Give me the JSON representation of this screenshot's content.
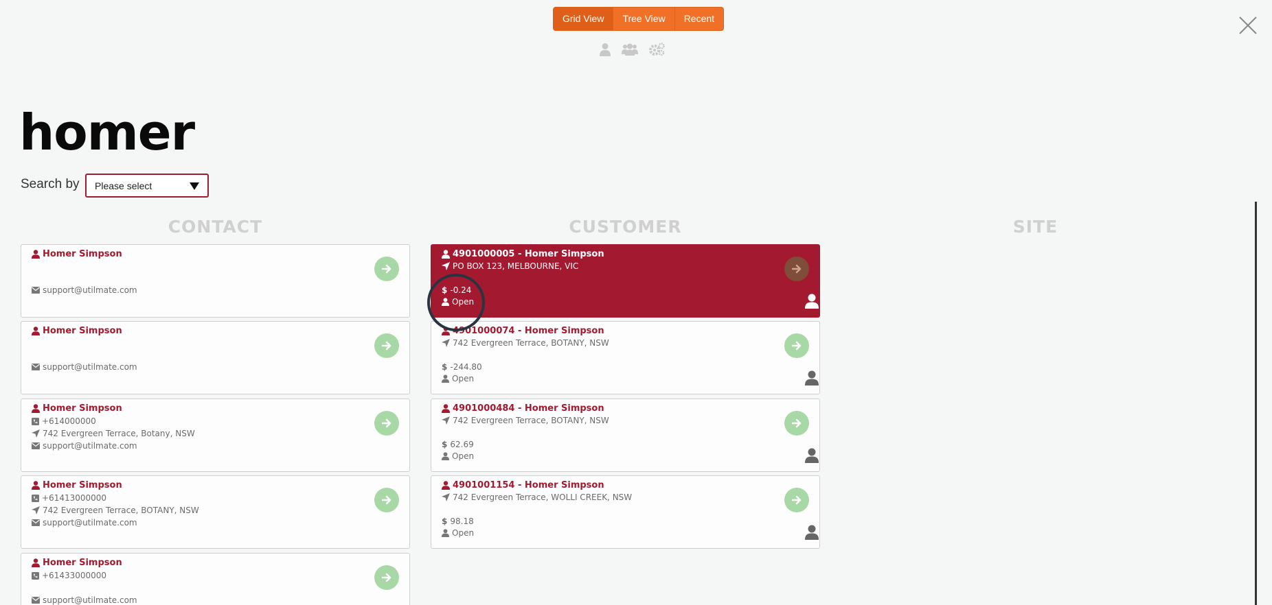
{
  "view_toggle": {
    "grid": "Grid View",
    "tree": "Tree View",
    "recent": "Recent",
    "active": "grid"
  },
  "type_icons": [
    "user-icon",
    "users-icon",
    "cogs-icon"
  ],
  "page": {
    "title": "homer"
  },
  "search": {
    "label": "Search by",
    "select_value": "Please select"
  },
  "columns": {
    "contact": "CONTACT",
    "customer": "CUSTOMER",
    "site": "SITE"
  },
  "contacts": [
    {
      "name": "Homer Simpson",
      "email": "support@utilmate.com"
    },
    {
      "name": "Homer Simpson",
      "email": "support@utilmate.com"
    },
    {
      "name": "Homer Simpson",
      "phone": "+614000000",
      "address": "742 Evergreen Terrace, Botany, NSW",
      "email": "support@utilmate.com"
    },
    {
      "name": "Homer Simpson",
      "phone": "+61413000000",
      "address": "742 Evergreen Terrace, BOTANY, NSW",
      "email": "support@utilmate.com"
    },
    {
      "name": "Homer Simpson",
      "phone": "+61433000000",
      "email": "support@utilmate.com"
    }
  ],
  "customers": [
    {
      "title": "4901000005 - Homer Simpson",
      "address": "PO BOX 123, MELBOURNE, VIC",
      "balance": "-0.24",
      "status": "Open",
      "selected": true
    },
    {
      "title": "4901000074 - Homer Simpson",
      "address": "742 Evergreen Terrace, BOTANY, NSW",
      "balance": "-244.80",
      "status": "Open"
    },
    {
      "title": "4901000484 - Homer Simpson",
      "address": "742 Evergreen Terrace, BOTANY, NSW",
      "balance": "62.69",
      "status": "Open"
    },
    {
      "title": "4901001154 - Homer Simpson",
      "address": "742 Evergreen Terrace, WOLLI CREEK, NSW",
      "balance": "98.18",
      "status": "Open"
    }
  ],
  "colors": {
    "brand_red": "#a31a30",
    "accent_orange": "#f07028",
    "go_green": "#a8d8a6",
    "heading_grey": "#d0d0d0"
  }
}
